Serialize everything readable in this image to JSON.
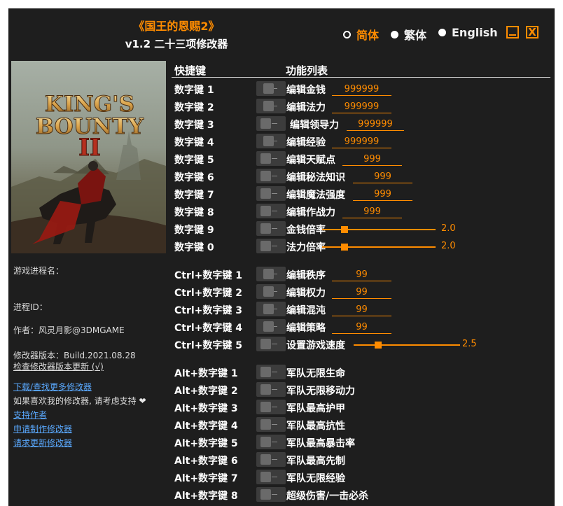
{
  "header": {
    "title": "《国王的恩赐2》",
    "subtitle": "v1.2 二十三项修改器",
    "languages": [
      {
        "label": "简体",
        "selected": true
      },
      {
        "label": "繁体",
        "selected": false
      },
      {
        "label": "English",
        "selected": false
      }
    ],
    "minimize_icon": "minimize-icon",
    "close_label": "X",
    "accent_color": "#ff8c00"
  },
  "cover": {
    "logo_line1": "KING'S",
    "logo_line2": "BOUNTY",
    "logo_numeral": "II"
  },
  "sidebar": {
    "process_name_label": "游戏进程名：",
    "process_id_label": "进程ID：",
    "author": "作者：风灵月影@3DMGAME",
    "version": "修改器版本：Build.2021.08.28",
    "check_update": "检查修改器版本更新 (√)",
    "links": [
      "下载/查找更多修改器",
      "支持作者",
      "申请制作修改器",
      "请求更新修改器"
    ],
    "support_text": "如果喜欢我的修改器, 请考虑支持",
    "heart": "❤"
  },
  "columns": {
    "hotkey": "快捷键",
    "functions": "功能列表"
  },
  "cheats": [
    {
      "key": "数字键 1",
      "label": "编辑金钱",
      "value": "999999"
    },
    {
      "key": "数字键 2",
      "label": "编辑法力",
      "value": "999999"
    },
    {
      "key": "数字键 3",
      "label": "编辑领导力",
      "value": "999999"
    },
    {
      "key": "数字键 4",
      "label": "编辑经验",
      "value": "999999"
    },
    {
      "key": "数字键 5",
      "label": "编辑天赋点",
      "value": "999"
    },
    {
      "key": "数字键 6",
      "label": "编辑秘法知识",
      "value": "999"
    },
    {
      "key": "数字键 7",
      "label": "编辑魔法强度",
      "value": "999"
    },
    {
      "key": "数字键 8",
      "label": "编辑作战力",
      "value": "999"
    },
    {
      "key": "数字键 9",
      "label": "金钱倍率",
      "slider": 2.0,
      "slider_text": "2.0"
    },
    {
      "key": "数字键 0",
      "label": "法力倍率",
      "slider": 2.0,
      "slider_text": "2.0"
    },
    {
      "key": "Ctrl+数字键 1",
      "label": "编辑秩序",
      "value": "99"
    },
    {
      "key": "Ctrl+数字键 2",
      "label": "编辑权力",
      "value": "99"
    },
    {
      "key": "Ctrl+数字键 3",
      "label": "编辑混沌",
      "value": "99"
    },
    {
      "key": "Ctrl+数字键 4",
      "label": "编辑策略",
      "value": "99"
    },
    {
      "key": "Ctrl+数字键 5",
      "label": "设置游戏速度",
      "slider": 2.5,
      "slider_text": "2.5"
    },
    {
      "key": "Alt+数字键 1",
      "label": "军队无限生命"
    },
    {
      "key": "Alt+数字键 2",
      "label": "军队无限移动力"
    },
    {
      "key": "Alt+数字键 3",
      "label": "军队最高护甲"
    },
    {
      "key": "Alt+数字键 4",
      "label": "军队最高抗性"
    },
    {
      "key": "Alt+数字键 5",
      "label": "军队最高暴击率"
    },
    {
      "key": "Alt+数字键 6",
      "label": "军队最高先制"
    },
    {
      "key": "Alt+数字键 7",
      "label": "军队无限经验"
    },
    {
      "key": "Alt+数字键 8",
      "label": "超级伤害/一击必杀"
    }
  ]
}
